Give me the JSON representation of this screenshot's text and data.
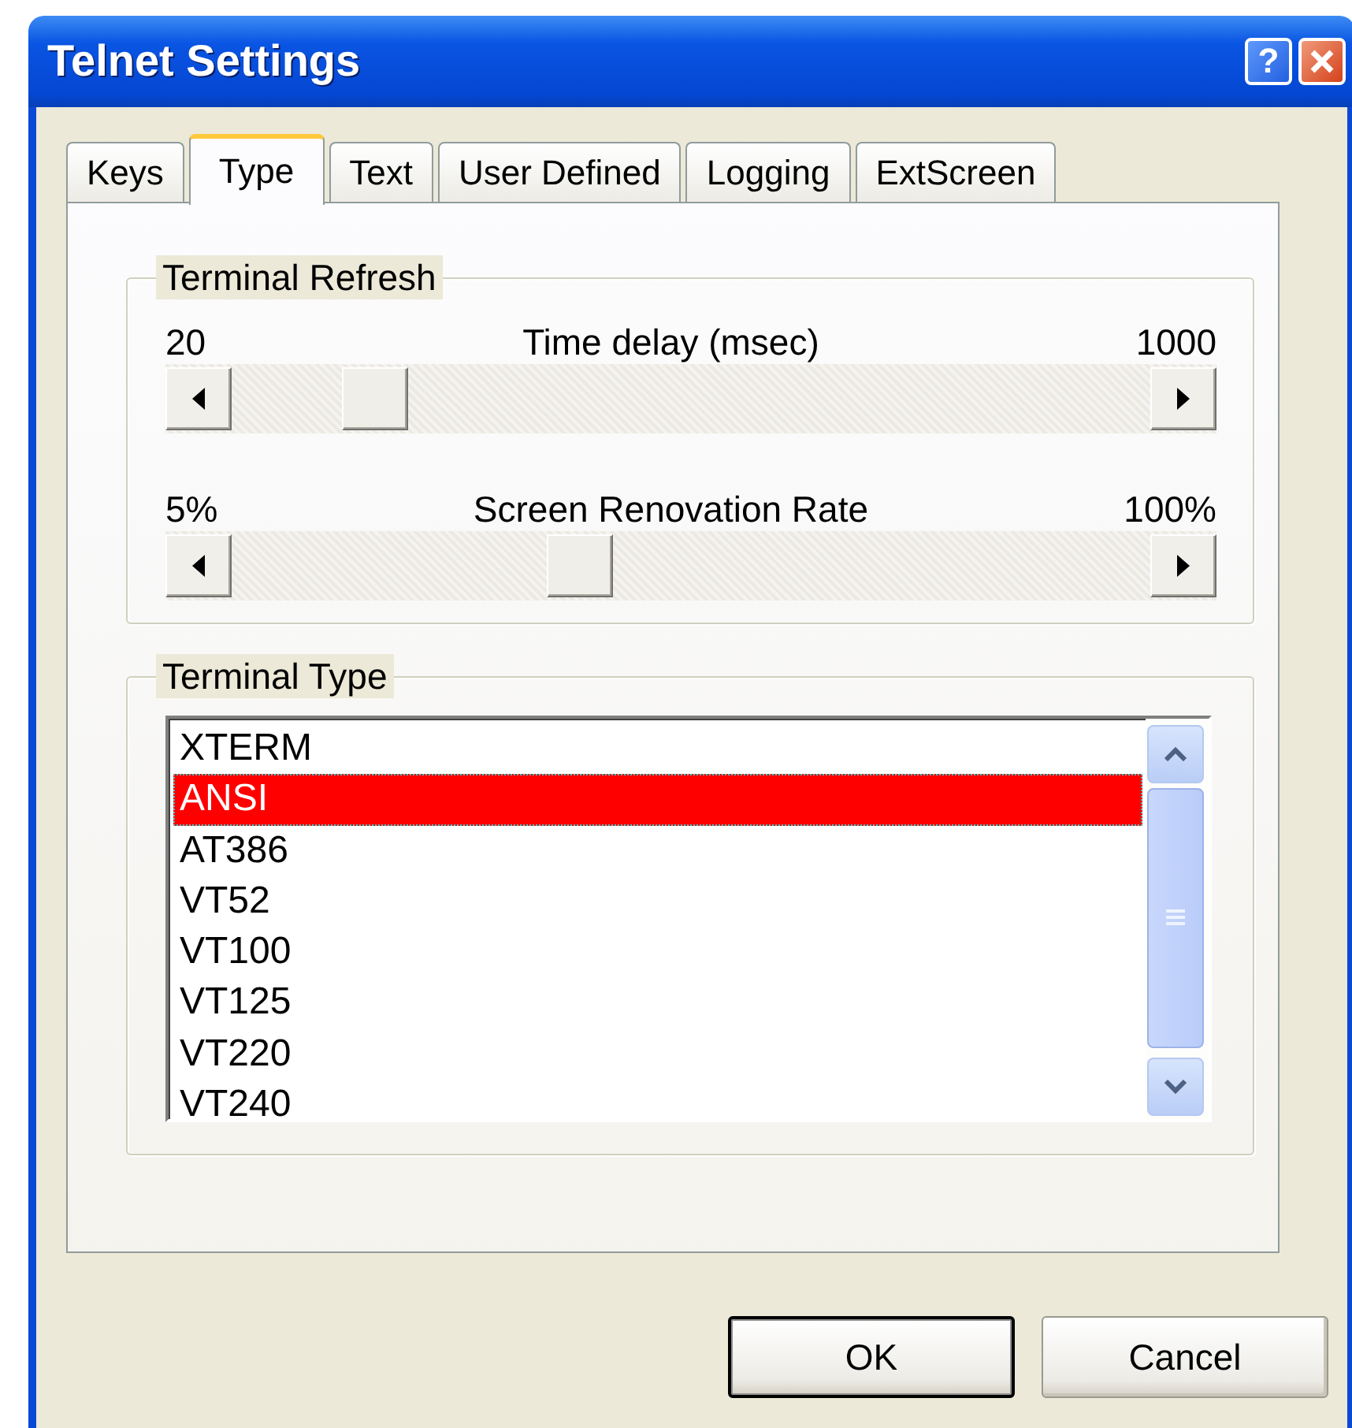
{
  "window": {
    "title": "Telnet Settings",
    "help_button": "?"
  },
  "tabs": [
    {
      "label": "Keys",
      "selected": false
    },
    {
      "label": "Type",
      "selected": true
    },
    {
      "label": "Text",
      "selected": false
    },
    {
      "label": "User Defined",
      "selected": false
    },
    {
      "label": "Logging",
      "selected": false
    },
    {
      "label": "ExtScreen",
      "selected": false
    }
  ],
  "terminal_refresh": {
    "title": "Terminal Refresh",
    "sliders": [
      {
        "label": "Time delay (msec)",
        "min": "20",
        "max": "1000",
        "level": 0.13
      },
      {
        "label": "Screen Renovation Rate",
        "min": "5%",
        "max": "100%",
        "level": 0.37
      }
    ]
  },
  "terminal_type": {
    "title": "Terminal Type",
    "items": [
      {
        "label": "XTERM",
        "selected": false
      },
      {
        "label": "ANSI",
        "selected": true
      },
      {
        "label": "AT386",
        "selected": false
      },
      {
        "label": "VT52",
        "selected": false
      },
      {
        "label": "VT100",
        "selected": false
      },
      {
        "label": "VT125",
        "selected": false
      },
      {
        "label": "VT220",
        "selected": false
      },
      {
        "label": "VT240",
        "selected": false
      }
    ]
  },
  "buttons": [
    {
      "label": "OK",
      "kind": "default"
    },
    {
      "label": "Cancel",
      "kind": "normal"
    }
  ]
}
